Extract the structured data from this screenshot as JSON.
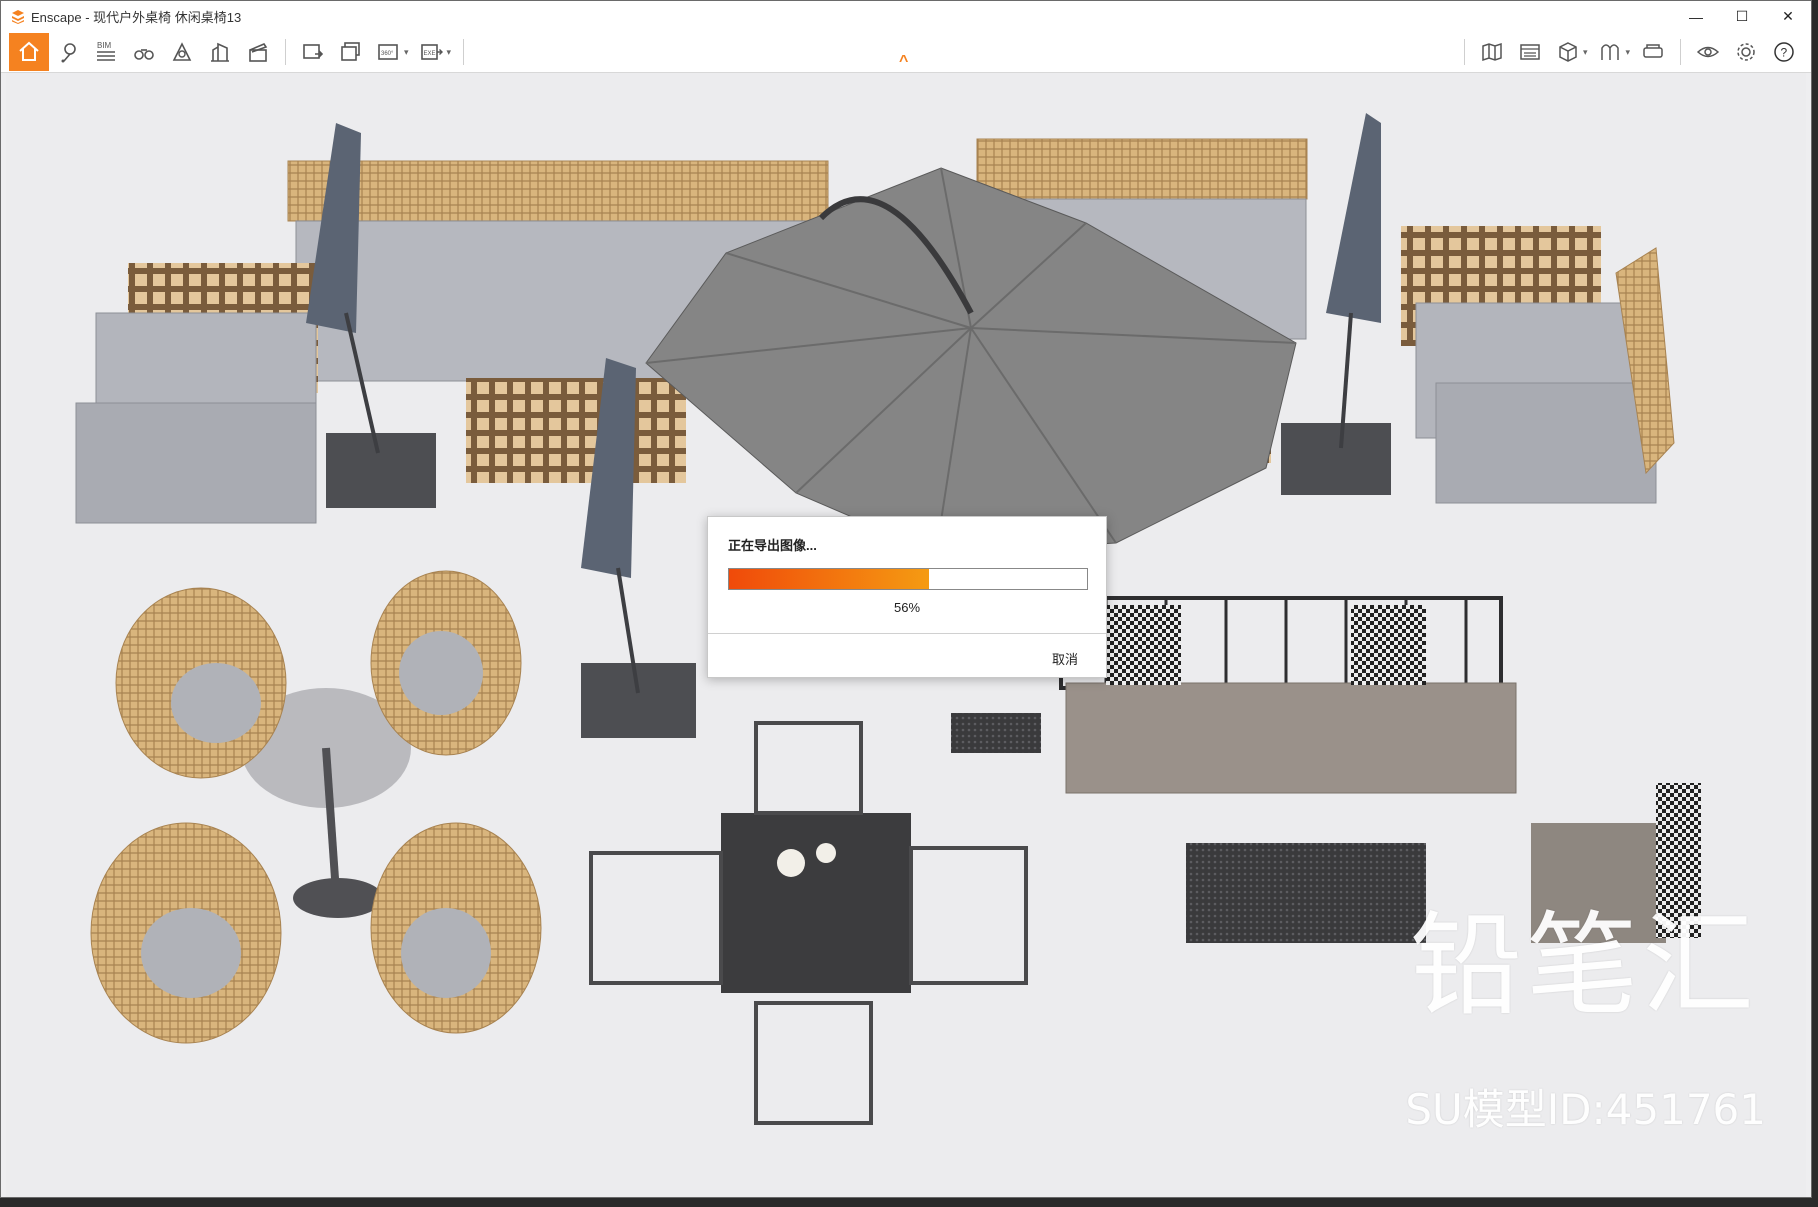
{
  "window": {
    "title": "Enscape - 现代户外桌椅 休闲桌椅13",
    "controls": [
      "—",
      "☐",
      "✕"
    ]
  },
  "toolbar": {
    "left_buttons": [
      {
        "icon": "home-icon"
      },
      {
        "icon": "location-pin-icon"
      },
      {
        "icon": "bim-icon",
        "label": "BIM"
      },
      {
        "icon": "binoculars-icon"
      },
      {
        "icon": "sun-icon"
      },
      {
        "icon": "buildings-icon"
      },
      {
        "icon": "clapper-icon"
      },
      {
        "icon": "screenshot-icon"
      },
      {
        "icon": "batch-render-icon"
      },
      {
        "icon": "panorama-icon",
        "label": "360°"
      },
      {
        "icon": "export-exe-icon",
        "label": "EXE"
      }
    ],
    "right_buttons": [
      {
        "icon": "map-icon"
      },
      {
        "icon": "asset-library-icon"
      },
      {
        "icon": "cube-view-icon"
      },
      {
        "icon": "materials-icon"
      },
      {
        "icon": "vr-headset-icon"
      },
      {
        "icon": "visual-settings-eye-icon"
      },
      {
        "icon": "settings-gear-icon"
      },
      {
        "icon": "help-icon"
      }
    ],
    "accent_color": "#f58220"
  },
  "dialog": {
    "title": "正在导出图像...",
    "progress": 0.56,
    "percent_label": "56%",
    "cancel_label": "取消"
  },
  "watermark": {
    "brand": "铅笔汇",
    "model_id": "SU模型ID:451761"
  }
}
